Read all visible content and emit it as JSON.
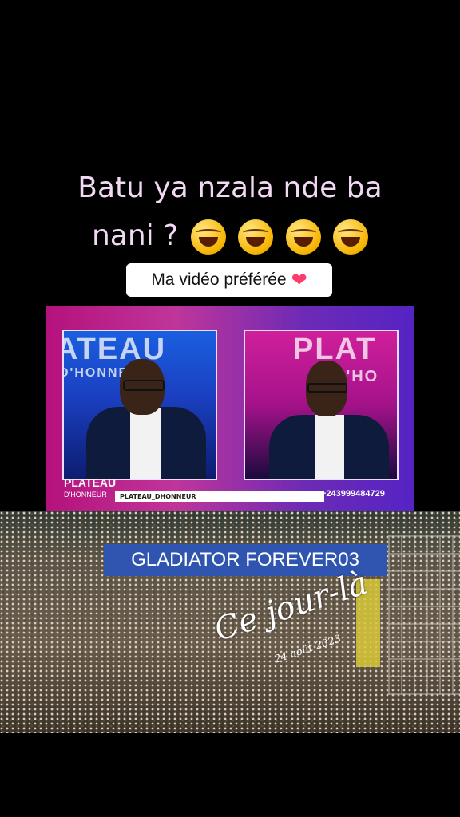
{
  "caption": {
    "line1": "Batu ya nzala nde ba",
    "line2": "nani ?",
    "emojis": [
      "laughing-tears-emoji",
      "laughing-tears-emoji",
      "laughing-tears-emoji",
      "laughing-tears-emoji"
    ]
  },
  "sticker": {
    "label": "Ma vidéo préférée",
    "icon": "red-heart-icon"
  },
  "tv": {
    "left_bg_text": "ATEAU",
    "left_bg_text2": "D'HONNEUR",
    "right_bg_text": "PLAT",
    "right_bg_text2": "D'HO",
    "brand_line1": "PLATEAU",
    "brand_line2": "D'HONNEUR",
    "ticker": "PLATEAU_DHONNEUR",
    "phone": "+243999484729"
  },
  "overlay": {
    "banner": "GLADIATOR FOREVER03",
    "script_text": "Ce jour-là",
    "date": "24 août 2023"
  },
  "colors": {
    "accent_blue": "#2f55b0",
    "heart": "#ff3b6b",
    "tv_pink": "#b5117c",
    "tv_purple": "#5523c4"
  }
}
